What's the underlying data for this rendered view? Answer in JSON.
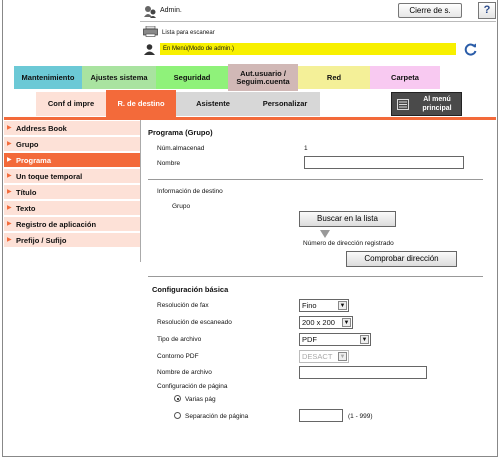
{
  "header": {
    "user_label": "Admin.",
    "logout_label": "Cierre de s.",
    "help_label": "?",
    "status_text": "Lista para escanear",
    "mode_text": "En Menú(Modo de admin.)"
  },
  "top_tabs": [
    {
      "label": "Mantenimiento"
    },
    {
      "label": "Ajustes sistema"
    },
    {
      "label": "Seguridad"
    },
    {
      "label": "Aut.usuario / Seguim.cuenta"
    },
    {
      "label": "Red"
    },
    {
      "label": "Carpeta"
    }
  ],
  "sub_tabs": [
    {
      "label": "Conf d impre"
    },
    {
      "label": "R. de destino"
    },
    {
      "label": "Asistente"
    },
    {
      "label": "Personalizar"
    }
  ],
  "menu_button": {
    "label": "Al menú principal"
  },
  "sidebar": {
    "items": [
      {
        "label": "Address Book"
      },
      {
        "label": "Grupo"
      },
      {
        "label": "Programa"
      },
      {
        "label": "Un toque temporal"
      },
      {
        "label": "Título"
      },
      {
        "label": "Texto"
      },
      {
        "label": "Registro de aplicación"
      },
      {
        "label": "Prefijo / Sufijo"
      }
    ],
    "active_index": 2
  },
  "main": {
    "title": "Programa (Grupo)",
    "num_label": "Núm.almacenad",
    "num_value": "1",
    "name_label": "Nombre",
    "name_value": "",
    "dest_info_label": "Información de destino",
    "group_label": "Grupo",
    "search_button": "Buscar en la lista",
    "registered_label": "Número de dirección registrado",
    "check_button": "Comprobar dirección",
    "basic_title": "Configuración básica",
    "fax_res_label": "Resolución de fax",
    "fax_res_value": "Fino",
    "scan_res_label": "Resolución de escaneado",
    "scan_res_value": "200 x 200",
    "file_type_label": "Tipo de archivo",
    "file_type_value": "PDF",
    "pdf_outline_label": "Contorno PDF",
    "pdf_outline_value": "DESACT",
    "file_name_label": "Nombre de archivo",
    "file_name_value": "",
    "page_config_label": "Configuración de página",
    "multi_page_label": "Varias pág",
    "page_sep_label": "Separación de página",
    "page_sep_value": "",
    "page_sep_range": "(1 - 999)"
  },
  "colors": {
    "accent": "#f36a3a",
    "sidebar_bg": "#fde1d7",
    "mode_bar": "#f8f000"
  }
}
